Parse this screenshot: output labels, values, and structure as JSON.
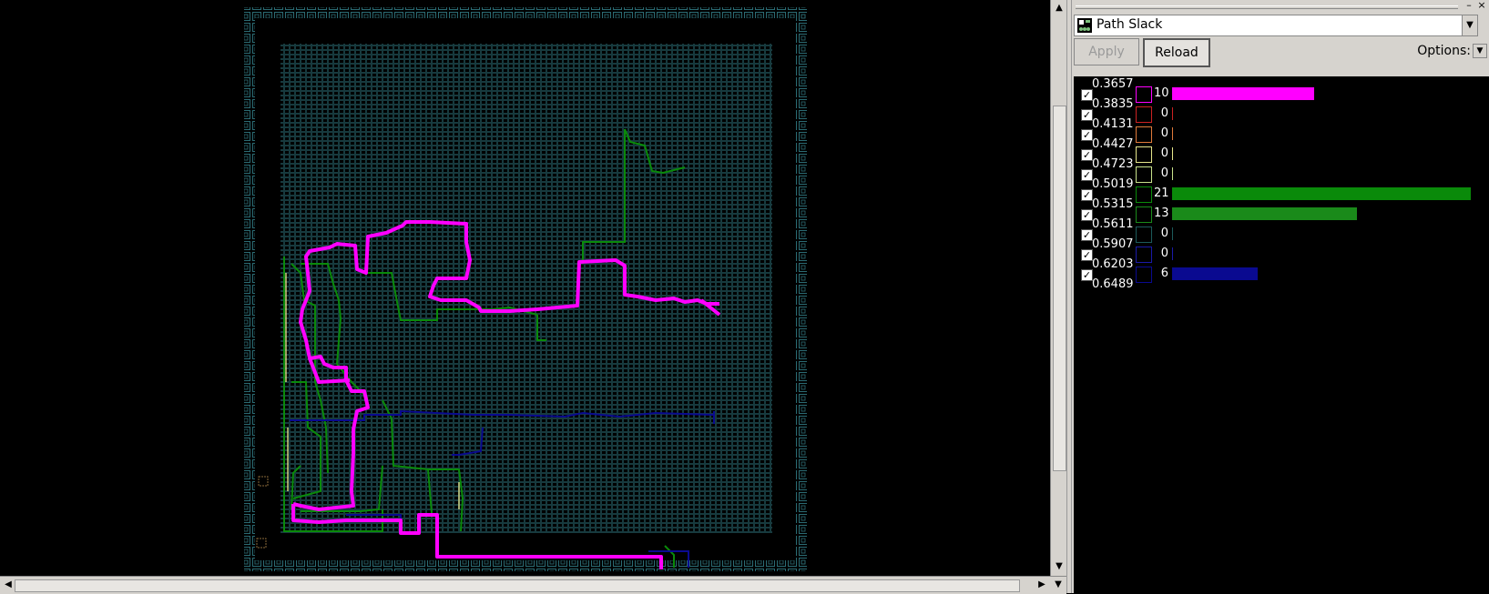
{
  "panel": {
    "combo": {
      "label": "Path Slack",
      "icon": "timing-widget-icon"
    },
    "apply_label": "Apply",
    "reload_label": "Reload",
    "options_label": "Options:"
  },
  "legend": {
    "thresholds": [
      "0.3657",
      "0.3835",
      "0.4131",
      "0.4427",
      "0.4723",
      "0.5019",
      "0.5315",
      "0.5611",
      "0.5907",
      "0.6203",
      "0.6489"
    ],
    "rows": [
      {
        "count": "10",
        "color": "#ff00ff",
        "checked": true,
        "fraction": 0.476
      },
      {
        "count": "0",
        "color": "#cc2222",
        "checked": true,
        "fraction": 0
      },
      {
        "count": "0",
        "color": "#e07a3a",
        "checked": true,
        "fraction": 0
      },
      {
        "count": "0",
        "color": "#e6e68a",
        "checked": true,
        "fraction": 0
      },
      {
        "count": "0",
        "color": "#c8e28a",
        "checked": true,
        "fraction": 0
      },
      {
        "count": "21",
        "color": "#0a8a0a",
        "checked": true,
        "fraction": 1.0
      },
      {
        "count": "13",
        "color": "#1a8a1a",
        "checked": true,
        "fraction": 0.62
      },
      {
        "count": "0",
        "color": "#1c5a5a",
        "checked": true,
        "fraction": 0
      },
      {
        "count": "0",
        "color": "#1a1aa8",
        "checked": true,
        "fraction": 0
      },
      {
        "count": "6",
        "color": "#0a0a90",
        "checked": true,
        "fraction": 0.286
      }
    ]
  },
  "colors": {
    "cell_grid": "#2b6b73",
    "pad_ring": "#2b6b73",
    "path_worst": "#ff00ff",
    "path_green": "#0a8a0a",
    "path_blue": "#0a0a90"
  }
}
